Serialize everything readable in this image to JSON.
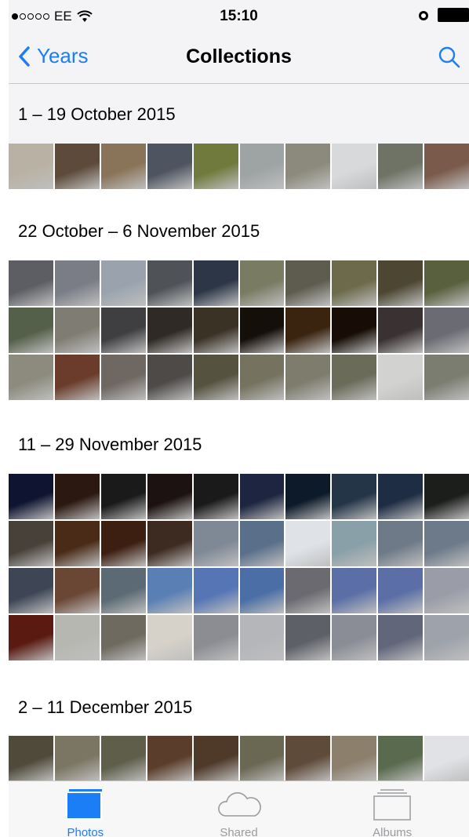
{
  "status": {
    "carrier": "EE",
    "time": "15:10"
  },
  "nav": {
    "back_label": "Years",
    "title": "Collections"
  },
  "collections": [
    {
      "title": "1 – 19 October 2015",
      "colors": [
        "#b9b2a4",
        "#5d4a3a",
        "#8a7459",
        "#4e5460",
        "#6f7a3c",
        "#9ea3a4",
        "#8c8a7c",
        "#d7d9db",
        "#6e7366",
        "#7a5a4a"
      ]
    },
    {
      "title": "22 October – 6 November 2015",
      "colors": [
        "#5c5e63",
        "#7a7d86",
        "#9aa3ad",
        "#4f5358",
        "#2c3647",
        "#7a7b63",
        "#5e5c4f",
        "#6c6a4a",
        "#4c4632",
        "#59603d",
        "#55604a",
        "#7f7d73",
        "#3f3e41",
        "#2f2a25",
        "#3b3226",
        "#150f0a",
        "#3a2410",
        "#170d06",
        "#3a3232",
        "#6b6c73",
        "#8c8b7e",
        "#6b3c2c",
        "#6e6762",
        "#4d4a48",
        "#55523f",
        "#757360",
        "#7d7c6d",
        "#6b6b5a",
        "#d2d2d0",
        "#7a7d70"
      ]
    },
    {
      "title": "11 – 29 November 2015",
      "colors": [
        "#0f1430",
        "#2b1810",
        "#1a1a1a",
        "#1c1211",
        "#1a1a1a",
        "#1d2540",
        "#0d1a2a",
        "#243548",
        "#1f2d44",
        "#1c1e1c",
        "#48413a",
        "#4a2b18",
        "#3d1f12",
        "#3d2a20",
        "#7f8895",
        "#5a6f8a",
        "#dfe3e8",
        "#8aa0a8",
        "#6e7a88",
        "#6d7a8a",
        "#3e4656",
        "#6a4635",
        "#5b6a74",
        "#5a7fb4",
        "#5575b5",
        "#4a6ea5",
        "#6a6a70",
        "#5b6fa6",
        "#5b6fa6",
        "#9a9ca8",
        "#5a1a12",
        "#b7b7b2",
        "#6e6a60",
        "#d6d2ca",
        "#8b8d92",
        "#b4b6ba",
        "#5e6068",
        "#8a8d96",
        "#62667a",
        "#9ea2aa"
      ]
    },
    {
      "title": "2 – 11 December 2015",
      "colors": [
        "#4f4a3a",
        "#7a7663",
        "#5e5e4a",
        "#5a3d2a",
        "#4f3a2a",
        "#6a6753",
        "#5f4b3a",
        "#8c7f6c",
        "#5a6a4e",
        "#e0e2e6"
      ]
    }
  ],
  "tabs": [
    {
      "label": "Photos",
      "icon": "photos-icon"
    },
    {
      "label": "Shared",
      "icon": "cloud-icon"
    },
    {
      "label": "Albums",
      "icon": "albums-icon"
    }
  ],
  "accent": "#1c7ef7"
}
